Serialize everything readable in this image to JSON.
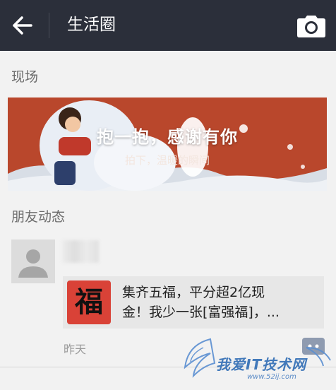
{
  "header": {
    "title": "生活圈"
  },
  "sections": {
    "live": "现场",
    "friends": "朋友动态"
  },
  "banner": {
    "title": "抱一抱，感谢有你",
    "subtitle": "拍下，温暖的瞬间"
  },
  "post": {
    "card_icon_char": "福",
    "card_text_line1": "集齐五福，平分超2亿现",
    "card_text_line2": "金！我少一张[富强福]，...",
    "time": "昨天"
  },
  "watermark": {
    "text": "我爱IT技术网",
    "url": "www.52ij.com"
  },
  "colors": {
    "topbar": "#2b2f3a",
    "banner_bg": "#b9472c",
    "fu_red": "#d94237",
    "background": "#f2f2f2"
  }
}
